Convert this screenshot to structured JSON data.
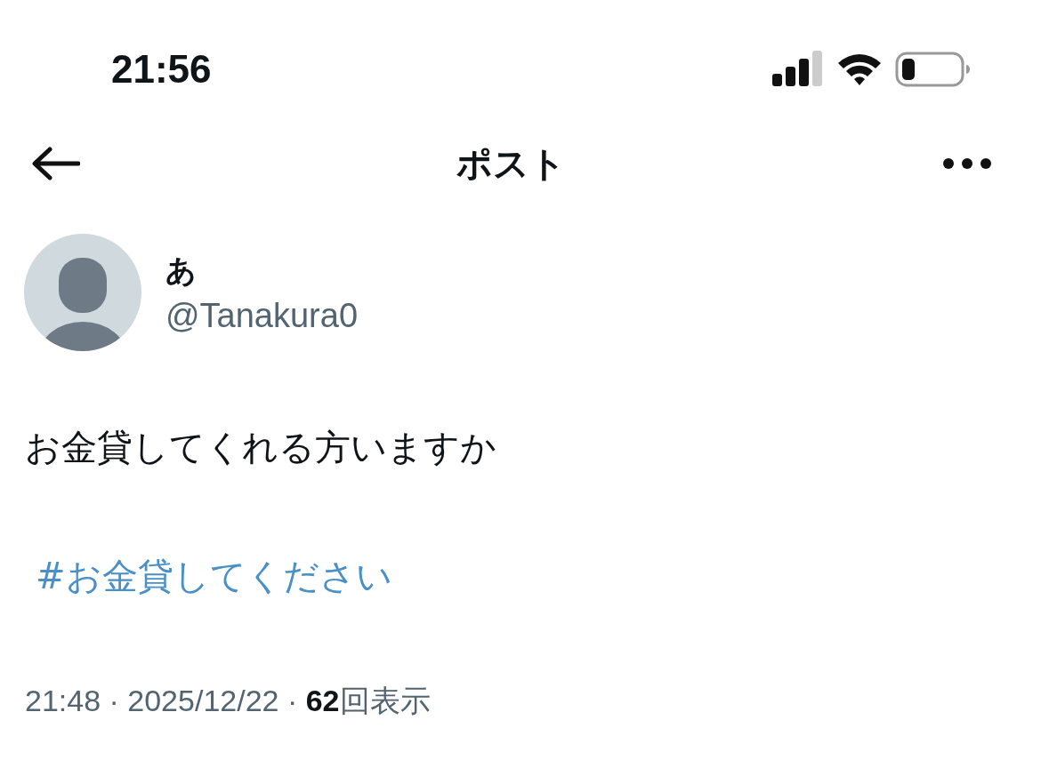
{
  "status_bar": {
    "time": "21:56"
  },
  "header": {
    "title": "ポスト"
  },
  "post": {
    "author": {
      "name": "あ",
      "handle": "@Tanakura0"
    },
    "text": "お金貸してくれる方いますか",
    "hashtag": "#お金貸してください",
    "meta": "21:48 · 2025/12/22 · **62**回表示"
  }
}
